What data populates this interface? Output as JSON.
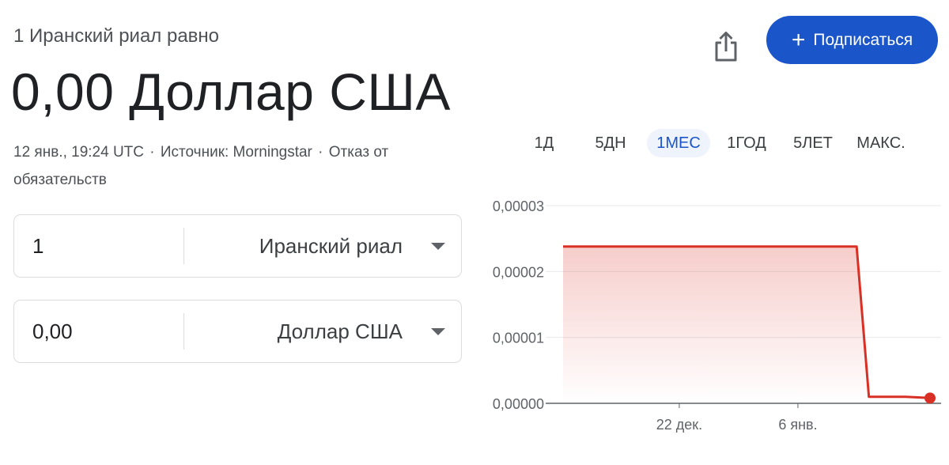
{
  "header": {
    "subtitle": "1 Иранский риал равно",
    "value": "0,00 Доллар США",
    "meta": {
      "timestamp": "12 янв., 19:24 UTC",
      "source": "Источник: Morningstar",
      "disclaimer": "Отказ от обязательств",
      "separator": "·"
    }
  },
  "actions": {
    "share_icon": "share-icon",
    "subscribe_label": "Подписаться",
    "subscribe_icon": "+",
    "accent": "#1a56c9"
  },
  "converter": {
    "from": {
      "amount": "1",
      "currency": "Иранский риал"
    },
    "to": {
      "amount": "0,00",
      "currency": "Доллар США"
    }
  },
  "ranges": {
    "tabs": [
      "1Д",
      "5ДН",
      "1МЕС",
      "1ГОД",
      "5ЛЕТ",
      "МАКС."
    ],
    "selected": "1МЕС"
  },
  "chart_data": {
    "type": "area",
    "color": "#d93025",
    "y_ticks": [
      "0,00003",
      "0,00002",
      "0,00001",
      "0,00000"
    ],
    "ylim": [
      0,
      3e-05
    ],
    "x_ticks": [
      "22 дек.",
      "6 янв."
    ],
    "series": [
      {
        "values": [
          2.38e-05,
          2.38e-05,
          2.38e-05,
          2.38e-05,
          2.38e-05,
          2.38e-05,
          2.38e-05,
          2.38e-05,
          2.38e-05,
          2.38e-05,
          2.38e-05,
          2.38e-05,
          2.38e-05,
          2.38e-05,
          2.38e-05,
          2.38e-05,
          2.38e-05,
          2.38e-05,
          2.38e-05,
          2.38e-05,
          2.38e-05,
          2.38e-05,
          2.38e-05,
          2.38e-05,
          2.38e-05,
          1e-06,
          1e-06,
          1e-06,
          1e-06,
          9e-07,
          8e-07
        ]
      }
    ]
  }
}
